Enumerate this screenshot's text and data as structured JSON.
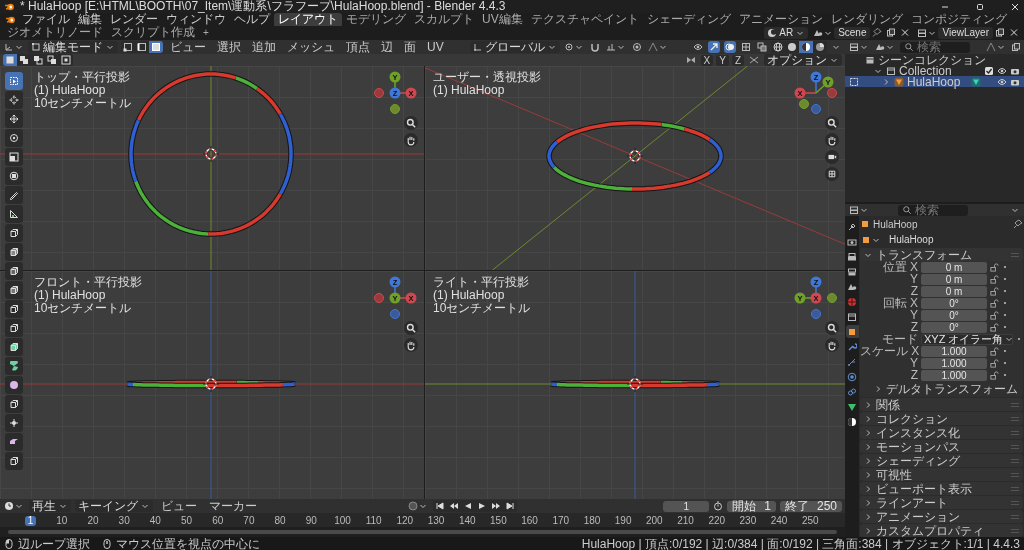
{
  "window": {
    "title": "* HulaHoop [E:\\HTML\\BOOTH\\07_Item\\運動系\\フラフープ\\HulaHoop.blend] - Blender 4.4.3"
  },
  "topbar": {
    "menus": [
      "ファイル",
      "編集",
      "レンダー",
      "ウィンドウ",
      "ヘルプ"
    ],
    "workspaces": [
      {
        "label": "レイアウト",
        "selected": true
      },
      {
        "label": "モデリング",
        "selected": false
      },
      {
        "label": "スカルプト",
        "selected": false
      },
      {
        "label": "UV編集",
        "selected": false
      },
      {
        "label": "テクスチャペイント",
        "selected": false
      },
      {
        "label": "シェーディング",
        "selected": false
      },
      {
        "label": "アニメーション",
        "selected": false
      },
      {
        "label": "レンダリング",
        "selected": false
      },
      {
        "label": "コンポジティング",
        "selected": false
      },
      {
        "label": "ジオメトリノード",
        "selected": false
      },
      {
        "label": "スクリプト作成",
        "selected": false
      }
    ],
    "add_workspace": "+",
    "engine": "AR",
    "scene": "Scene",
    "view_layer": "ViewLayer"
  },
  "viewport": {
    "mode": "編集モード",
    "select_modes": [
      {
        "kind": "vertex",
        "selected": false
      },
      {
        "kind": "edge",
        "selected": false
      },
      {
        "kind": "face",
        "selected": true
      }
    ],
    "menus": [
      "ビュー",
      "選択",
      "追加",
      "メッシュ",
      "頂点",
      "辺",
      "面",
      "UV"
    ],
    "orientation": "グローバル",
    "toggles": [
      {
        "kind": "visibility",
        "on": false
      },
      {
        "kind": "gizmo",
        "on": true
      },
      {
        "kind": "overlay",
        "on": true
      },
      {
        "kind": "mesh_edit",
        "on": false
      },
      {
        "kind": "xray",
        "on": false
      }
    ],
    "shading": [
      {
        "kind": "wireframe",
        "selected": false
      },
      {
        "kind": "solid",
        "selected": false
      },
      {
        "kind": "material",
        "selected": true
      },
      {
        "kind": "rendered",
        "selected": false
      }
    ],
    "selection_ops": [
      {
        "kind": "set",
        "selected": true
      },
      {
        "kind": "extend",
        "selected": false
      },
      {
        "kind": "subtract",
        "selected": false
      },
      {
        "kind": "invert",
        "selected": false
      },
      {
        "kind": "intersect",
        "selected": false
      }
    ],
    "mirror": [
      {
        "label": "X",
        "on": false
      },
      {
        "label": "Y",
        "on": false
      },
      {
        "label": "Z",
        "on": false
      }
    ],
    "options": "オプション",
    "tools": [
      {
        "kind": "select_box",
        "selected": true
      },
      {
        "kind": "cursor",
        "selected": false
      },
      {
        "kind": "move",
        "selected": false
      },
      {
        "kind": "rotate",
        "selected": false
      },
      {
        "kind": "scale",
        "selected": false
      },
      {
        "kind": "transform",
        "selected": false
      },
      {
        "kind": "annotate",
        "selected": false
      },
      {
        "kind": "measure",
        "selected": false
      },
      {
        "kind": "add_cube",
        "selected": false
      },
      {
        "kind": "extrude",
        "selected": false
      },
      {
        "kind": "inset",
        "selected": false
      },
      {
        "kind": "bevel",
        "selected": false
      },
      {
        "kind": "loop_cut",
        "selected": false
      },
      {
        "kind": "knife",
        "selected": false
      },
      {
        "kind": "poly_build",
        "selected": false
      },
      {
        "kind": "spin",
        "selected": false
      },
      {
        "kind": "smooth",
        "selected": false
      },
      {
        "kind": "edge_slide",
        "selected": false
      },
      {
        "kind": "shrink",
        "selected": false
      },
      {
        "kind": "shear",
        "selected": false
      },
      {
        "kind": "rip",
        "selected": false
      }
    ],
    "views": [
      {
        "kind": "top",
        "title": "トップ・平行投影",
        "object": "(1) HulaHoop",
        "scale": "10センチメートル",
        "axes": [
          {
            "label": "Y",
            "kind": "y_up"
          },
          {
            "label": "X",
            "kind": "x_right"
          },
          {
            "label": "Z",
            "kind": "z_center"
          }
        ],
        "negatives": [
          {
            "kind": "y_down"
          },
          {
            "kind": "x_left"
          }
        ],
        "nav": [
          {
            "kind": "zoom"
          },
          {
            "kind": "pan"
          }
        ]
      },
      {
        "kind": "perspective",
        "title": "ユーザー・透視投影",
        "object": "(1) HulaHoop",
        "axes": [
          {
            "label": "Z",
            "kind": "z_up"
          },
          {
            "label": "Y",
            "kind": "y_upright"
          },
          {
            "label": "X",
            "kind": "x_left"
          }
        ],
        "negatives": [
          {
            "kind": "x_right"
          },
          {
            "kind": "y_downleft"
          },
          {
            "kind": "z_down"
          }
        ],
        "nav": [
          {
            "kind": "zoom"
          },
          {
            "kind": "pan"
          },
          {
            "kind": "camera"
          },
          {
            "kind": "ortho"
          }
        ]
      },
      {
        "kind": "front",
        "title": "フロント・平行投影",
        "object": "(1) HulaHoop",
        "scale": "10センチメートル",
        "axes": [
          {
            "label": "Z",
            "kind": "z_up"
          },
          {
            "label": "X",
            "kind": "x_right"
          },
          {
            "label": "Y",
            "kind": "y_center"
          }
        ],
        "negatives": [
          {
            "kind": "z_down"
          },
          {
            "kind": "x_left"
          }
        ],
        "nav": [
          {
            "kind": "zoom"
          },
          {
            "kind": "pan"
          }
        ]
      },
      {
        "kind": "right",
        "title": "ライト・平行投影",
        "object": "(1) HulaHoop",
        "scale": "10センチメートル",
        "axes": [
          {
            "label": "Z",
            "kind": "z_up"
          },
          {
            "label": "Y",
            "kind": "y_left"
          },
          {
            "label": "X",
            "kind": "x_center"
          }
        ],
        "negatives": [
          {
            "kind": "z_down"
          },
          {
            "kind": "y_right"
          }
        ],
        "nav": [
          {
            "kind": "zoom"
          },
          {
            "kind": "pan"
          }
        ]
      }
    ]
  },
  "outliner": {
    "search_placeholder": "検索",
    "tree": [
      {
        "label": "シーンコレクション",
        "kind": "scene_collection",
        "selected": false,
        "children": [
          {
            "label": "Collection",
            "kind": "collection",
            "selected": false,
            "expanded": true,
            "checked": true,
            "children": [
              {
                "label": "HulaHoop",
                "kind": "mesh_object",
                "selected": true,
                "expanded": false
              }
            ]
          }
        ]
      }
    ]
  },
  "properties": {
    "search_placeholder": "検索",
    "tabs": [
      {
        "kind": "tool",
        "selected": false
      },
      {
        "kind": "render",
        "selected": false
      },
      {
        "kind": "output",
        "selected": false
      },
      {
        "kind": "view_layer",
        "selected": false
      },
      {
        "kind": "scene",
        "selected": false
      },
      {
        "kind": "world",
        "selected": false
      },
      {
        "kind": "collection",
        "selected": false
      },
      {
        "kind": "object",
        "selected": true
      },
      {
        "kind": "modifiers",
        "selected": false
      },
      {
        "kind": "particles",
        "selected": false
      },
      {
        "kind": "physics",
        "selected": false
      },
      {
        "kind": "constraints",
        "selected": false
      },
      {
        "kind": "data",
        "selected": false
      },
      {
        "kind": "material",
        "selected": false
      }
    ],
    "object_name": "HulaHoop",
    "datablock": "HulaHoop",
    "panels": [
      {
        "title": "トランスフォーム",
        "expanded": true,
        "rows": [
          {
            "label": "位置 X",
            "value": "0 m",
            "kind": "number"
          },
          {
            "label": "Y",
            "value": "0 m",
            "kind": "number"
          },
          {
            "label": "Z",
            "value": "0 m",
            "kind": "number"
          },
          {
            "label": "回転 X",
            "value": "0°",
            "kind": "number"
          },
          {
            "label": "Y",
            "value": "0°",
            "kind": "number"
          },
          {
            "label": "Z",
            "value": "0°",
            "kind": "number"
          },
          {
            "label": "モード",
            "value": "XYZ オイラー角",
            "kind": "dropdown"
          },
          {
            "label": "スケール X",
            "value": "1.000",
            "kind": "number"
          },
          {
            "label": "Y",
            "value": "1.000",
            "kind": "number"
          },
          {
            "label": "Z",
            "value": "1.000",
            "kind": "number"
          }
        ],
        "subpanels": [
          {
            "title": "デルタトランスフォーム",
            "expanded": false
          }
        ]
      },
      {
        "title": "関係",
        "expanded": false
      },
      {
        "title": "コレクション",
        "expanded": false
      },
      {
        "title": "インスタンス化",
        "expanded": false
      },
      {
        "title": "モーションパス",
        "expanded": false
      },
      {
        "title": "シェーディング",
        "expanded": false
      },
      {
        "title": "可視性",
        "expanded": false
      },
      {
        "title": "ビューポート表示",
        "expanded": false
      },
      {
        "title": "ラインアート",
        "expanded": false
      },
      {
        "title": "アニメーション",
        "expanded": false
      },
      {
        "title": "カスタムプロパティ",
        "expanded": false
      }
    ]
  },
  "timeline": {
    "menus": [
      {
        "label": "再生",
        "dropdown": true
      },
      {
        "label": "キーイング",
        "dropdown": true
      },
      {
        "label": "ビュー",
        "dropdown": false
      },
      {
        "label": "マーカー",
        "dropdown": false
      }
    ],
    "auto_keying": false,
    "transport": [
      {
        "kind": "jump_start"
      },
      {
        "kind": "prev_key"
      },
      {
        "kind": "play_reverse"
      },
      {
        "kind": "play"
      },
      {
        "kind": "next_key"
      },
      {
        "kind": "jump_end"
      }
    ],
    "current_frame": "1",
    "start_label": "開始",
    "start": "1",
    "end_label": "終了",
    "end": "250",
    "ruler": [
      {
        "label": "1",
        "selected": true
      },
      {
        "label": "10",
        "selected": false
      },
      {
        "label": "20",
        "selected": false
      },
      {
        "label": "30",
        "selected": false
      },
      {
        "label": "40",
        "selected": false
      },
      {
        "label": "50",
        "selected": false
      },
      {
        "label": "60",
        "selected": false
      },
      {
        "label": "70",
        "selected": false
      },
      {
        "label": "80",
        "selected": false
      },
      {
        "label": "90",
        "selected": false
      },
      {
        "label": "100",
        "selected": false
      },
      {
        "label": "110",
        "selected": false
      },
      {
        "label": "120",
        "selected": false
      },
      {
        "label": "130",
        "selected": false
      },
      {
        "label": "140",
        "selected": false
      },
      {
        "label": "150",
        "selected": false
      },
      {
        "label": "160",
        "selected": false
      },
      {
        "label": "170",
        "selected": false
      },
      {
        "label": "180",
        "selected": false
      },
      {
        "label": "190",
        "selected": false
      },
      {
        "label": "200",
        "selected": false
      },
      {
        "label": "210",
        "selected": false
      },
      {
        "label": "220",
        "selected": false
      },
      {
        "label": "230",
        "selected": false
      },
      {
        "label": "240",
        "selected": false
      },
      {
        "label": "250",
        "selected": false
      }
    ]
  },
  "status": {
    "hints": [
      {
        "kind": "mouse_left",
        "text": "辺ループ選択"
      },
      {
        "kind": "mouse_middle",
        "text": "マウス位置を視点の中心に"
      }
    ],
    "stats": "HulaHoop | 頂点:0/192 | 辺:0/384 | 面:0/192 | 三角面:384 | オブジェクト:1/1 | 4.4.3"
  }
}
